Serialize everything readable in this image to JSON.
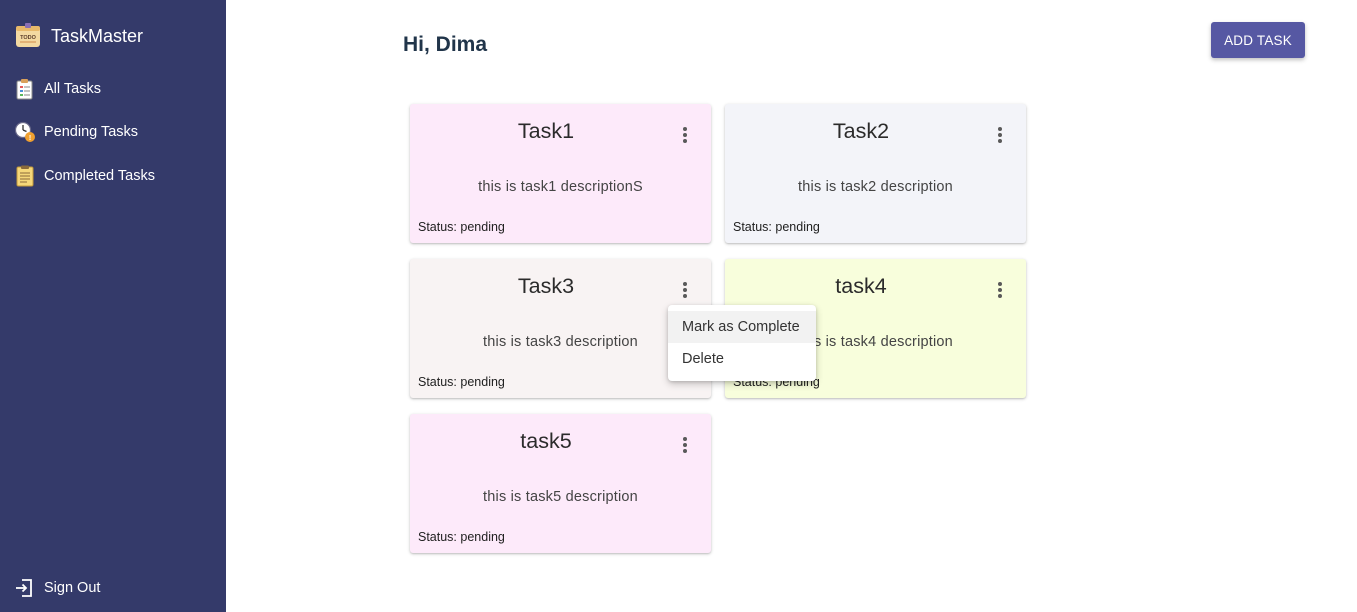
{
  "app": {
    "brand_title": "TaskMaster",
    "logo_text": "TODO"
  },
  "sidebar": {
    "items": [
      {
        "label": "All Tasks",
        "icon": "all-tasks-icon"
      },
      {
        "label": "Pending Tasks",
        "icon": "pending-clock-icon"
      },
      {
        "label": "Completed Tasks",
        "icon": "completed-clipboard-icon"
      }
    ],
    "signout_label": "Sign Out"
  },
  "header": {
    "greeting": "Hi, Dima",
    "add_button_label": "ADD TASK"
  },
  "tasks": [
    {
      "title": "Task1",
      "description": "this is task1 descriptionS",
      "status": "Status: pending",
      "color": "#fdeafa"
    },
    {
      "title": "Task2",
      "description": "this is task2 description",
      "status": "Status: pending",
      "color": "#f3f4f9"
    },
    {
      "title": "Task3",
      "description": "this is task3 description",
      "status": "Status: pending",
      "color": "#f8f3f3"
    },
    {
      "title": "task4",
      "description": "this is task4 description",
      "status": "Status: pending",
      "color": "#f8fedc"
    },
    {
      "title": "task5",
      "description": "this is task5 description",
      "status": "Status: pending",
      "color": "#fdeafa"
    }
  ],
  "context_menu": {
    "items": [
      "Mark as Complete",
      "Delete"
    ]
  },
  "colors": {
    "sidebar_bg": "#343a6a",
    "accent_button": "#5658a3",
    "heading": "#21354a"
  }
}
